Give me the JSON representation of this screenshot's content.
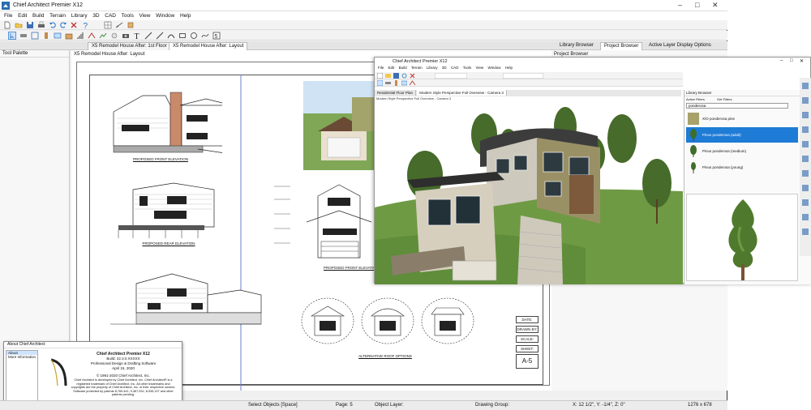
{
  "app": {
    "title": "Chief Architect Premier X12",
    "menu": [
      "File",
      "Edit",
      "Build",
      "Terrain",
      "Library",
      "3D",
      "CAD",
      "Tools",
      "View",
      "Window",
      "Help"
    ]
  },
  "tabs": {
    "documents": [
      "X5 Remodel House After: 1st Floor",
      "X5 Remodel House After: Layout"
    ],
    "dock": [
      "Library Browser",
      "Project Browser",
      "Active Layer Display Options"
    ]
  },
  "tool_palette": {
    "title": "Tool Palette"
  },
  "layout": {
    "title": "X5 Remodel House After: Layout",
    "elevation_captions": [
      "PROPOSED FRONT ELEVATION",
      "PROPOSED REAR ELEVATION",
      "PROPOSED FRONT ELEVATION",
      "ALTERNATIVE ROOF OPTIONS"
    ],
    "title_block": [
      "DATE:",
      "DRAWN BY:",
      "SCALE:",
      "SHEET:"
    ],
    "sheet_number": "A-5"
  },
  "project_browser": {
    "title": "Project Browser"
  },
  "about_dialog": {
    "title": "About Chief Architect",
    "list": [
      "About",
      "More Information"
    ],
    "product": "Chief Architect Premier X12",
    "build": "Build: 22.3.0.XXXXX",
    "tagline": "Professional Design & Drafting Software",
    "date": "April 15, 2020",
    "copyright": "© 1991-2020 Chief Architect, Inc.",
    "legal": "Chief Architect is developed by Chief Architect, Inc. Chief Architect® is a registered trademark of Chief Architect, Inc. All other trademarks and copyrights are the property of Chief Architect, Inc. or their respective owners. Software protected by patents 8,769,441; 9,367,931; 8,935,137 and other patents pending."
  },
  "statusbar": {
    "select": "Select Objects [Space]",
    "page": "Page: 5",
    "layer": "Object Layer:",
    "group": "Drawing Group:",
    "coords": "X: 12 1/2\", Y: -1/4\", Z: 0\"",
    "size": "1276 x 678"
  },
  "overlay": {
    "title": "Chief Architect Premier X12",
    "menu": [
      "File",
      "Edit",
      "Build",
      "Terrain",
      "Library",
      "3D",
      "CAD",
      "Tools",
      "View",
      "Window",
      "Help"
    ],
    "tabs": [
      "Residential Floor Plan",
      "Modern Style Perspective Full Overview - Camera 3"
    ],
    "library": {
      "title": "Library Browser",
      "filters": [
        "Active Filters",
        "Get Filters"
      ],
      "search": "ponderosa",
      "items": [
        {
          "label": "X/O ponderosa pine",
          "selected": false
        },
        {
          "label": "Pinus ponderosa (adult)",
          "selected": true
        },
        {
          "label": "Pinus ponderosa (medium)",
          "selected": false
        },
        {
          "label": "Pinus ponderosa (young)",
          "selected": false
        }
      ]
    }
  },
  "colors": {
    "accent": "#1e7bd6",
    "grass": "#5f8d3a",
    "sky": "#ffffff"
  }
}
